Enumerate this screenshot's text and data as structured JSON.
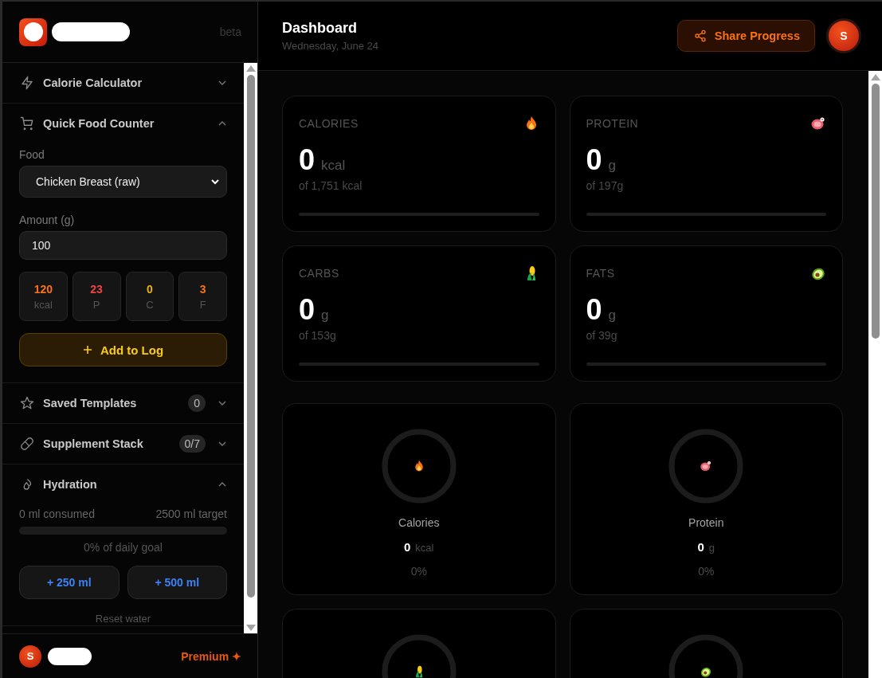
{
  "sidebar": {
    "badge": "beta",
    "sections": [
      {
        "title": "Calorie Calculator",
        "expanded": false
      },
      {
        "kind": "food",
        "title": "Quick Food Counter",
        "expanded": true,
        "food_label": "Food",
        "food_value": "Chicken Breast (raw)",
        "amount_label": "Amount (g)",
        "amount_value": "100",
        "macros": [
          {
            "value": "120",
            "unit": "kcal",
            "color": "#f97316"
          },
          {
            "value": "23",
            "unit": "P",
            "color": "#ef4444"
          },
          {
            "value": "0",
            "unit": "C",
            "color": "#eab308"
          },
          {
            "value": "3",
            "unit": "F",
            "color": "#f97316"
          }
        ],
        "add_button": "Add to Log"
      },
      {
        "title": "Saved Templates",
        "count": "0",
        "expanded": false
      },
      {
        "title": "Supplement Stack",
        "count": "0/7",
        "expanded": false
      },
      {
        "kind": "hydration",
        "title": "Hydration",
        "expanded": true,
        "consumed": "0 ml consumed",
        "target": "2500 ml target",
        "level": 0,
        "goal": "0% of daily goal",
        "buttons": [
          "+ 250 ml",
          "+ 500 ml"
        ],
        "reset": "Reset water"
      }
    ],
    "footer": {
      "avatar": "S",
      "premium": "Premium ✦"
    }
  },
  "header": {
    "title": "Dashboard",
    "date": "Wednesday, June 24",
    "share_button": "Share Progress",
    "avatar": "S"
  },
  "metrics": [
    {
      "label": "CALORIES",
      "value": "0",
      "unit": "kcal",
      "target": "of 1,751 kcal",
      "level": 0
    },
    {
      "label": "PROTEIN",
      "value": "0",
      "unit": "g",
      "target": "of 197g",
      "level": 0
    },
    {
      "label": "CARBS",
      "value": "0",
      "unit": "g",
      "target": "of 153g",
      "level": 0
    },
    {
      "label": "FATS",
      "value": "0",
      "unit": "g",
      "target": "of 39g",
      "level": 0
    }
  ],
  "rings": [
    {
      "label": "Calories",
      "value": "0",
      "unit": "kcal",
      "percent": "0%",
      "level": 0
    },
    {
      "label": "Protein",
      "value": "0",
      "unit": "g",
      "percent": "0%",
      "level": 0
    },
    {
      "level": 0
    },
    {
      "level": 0
    }
  ]
}
